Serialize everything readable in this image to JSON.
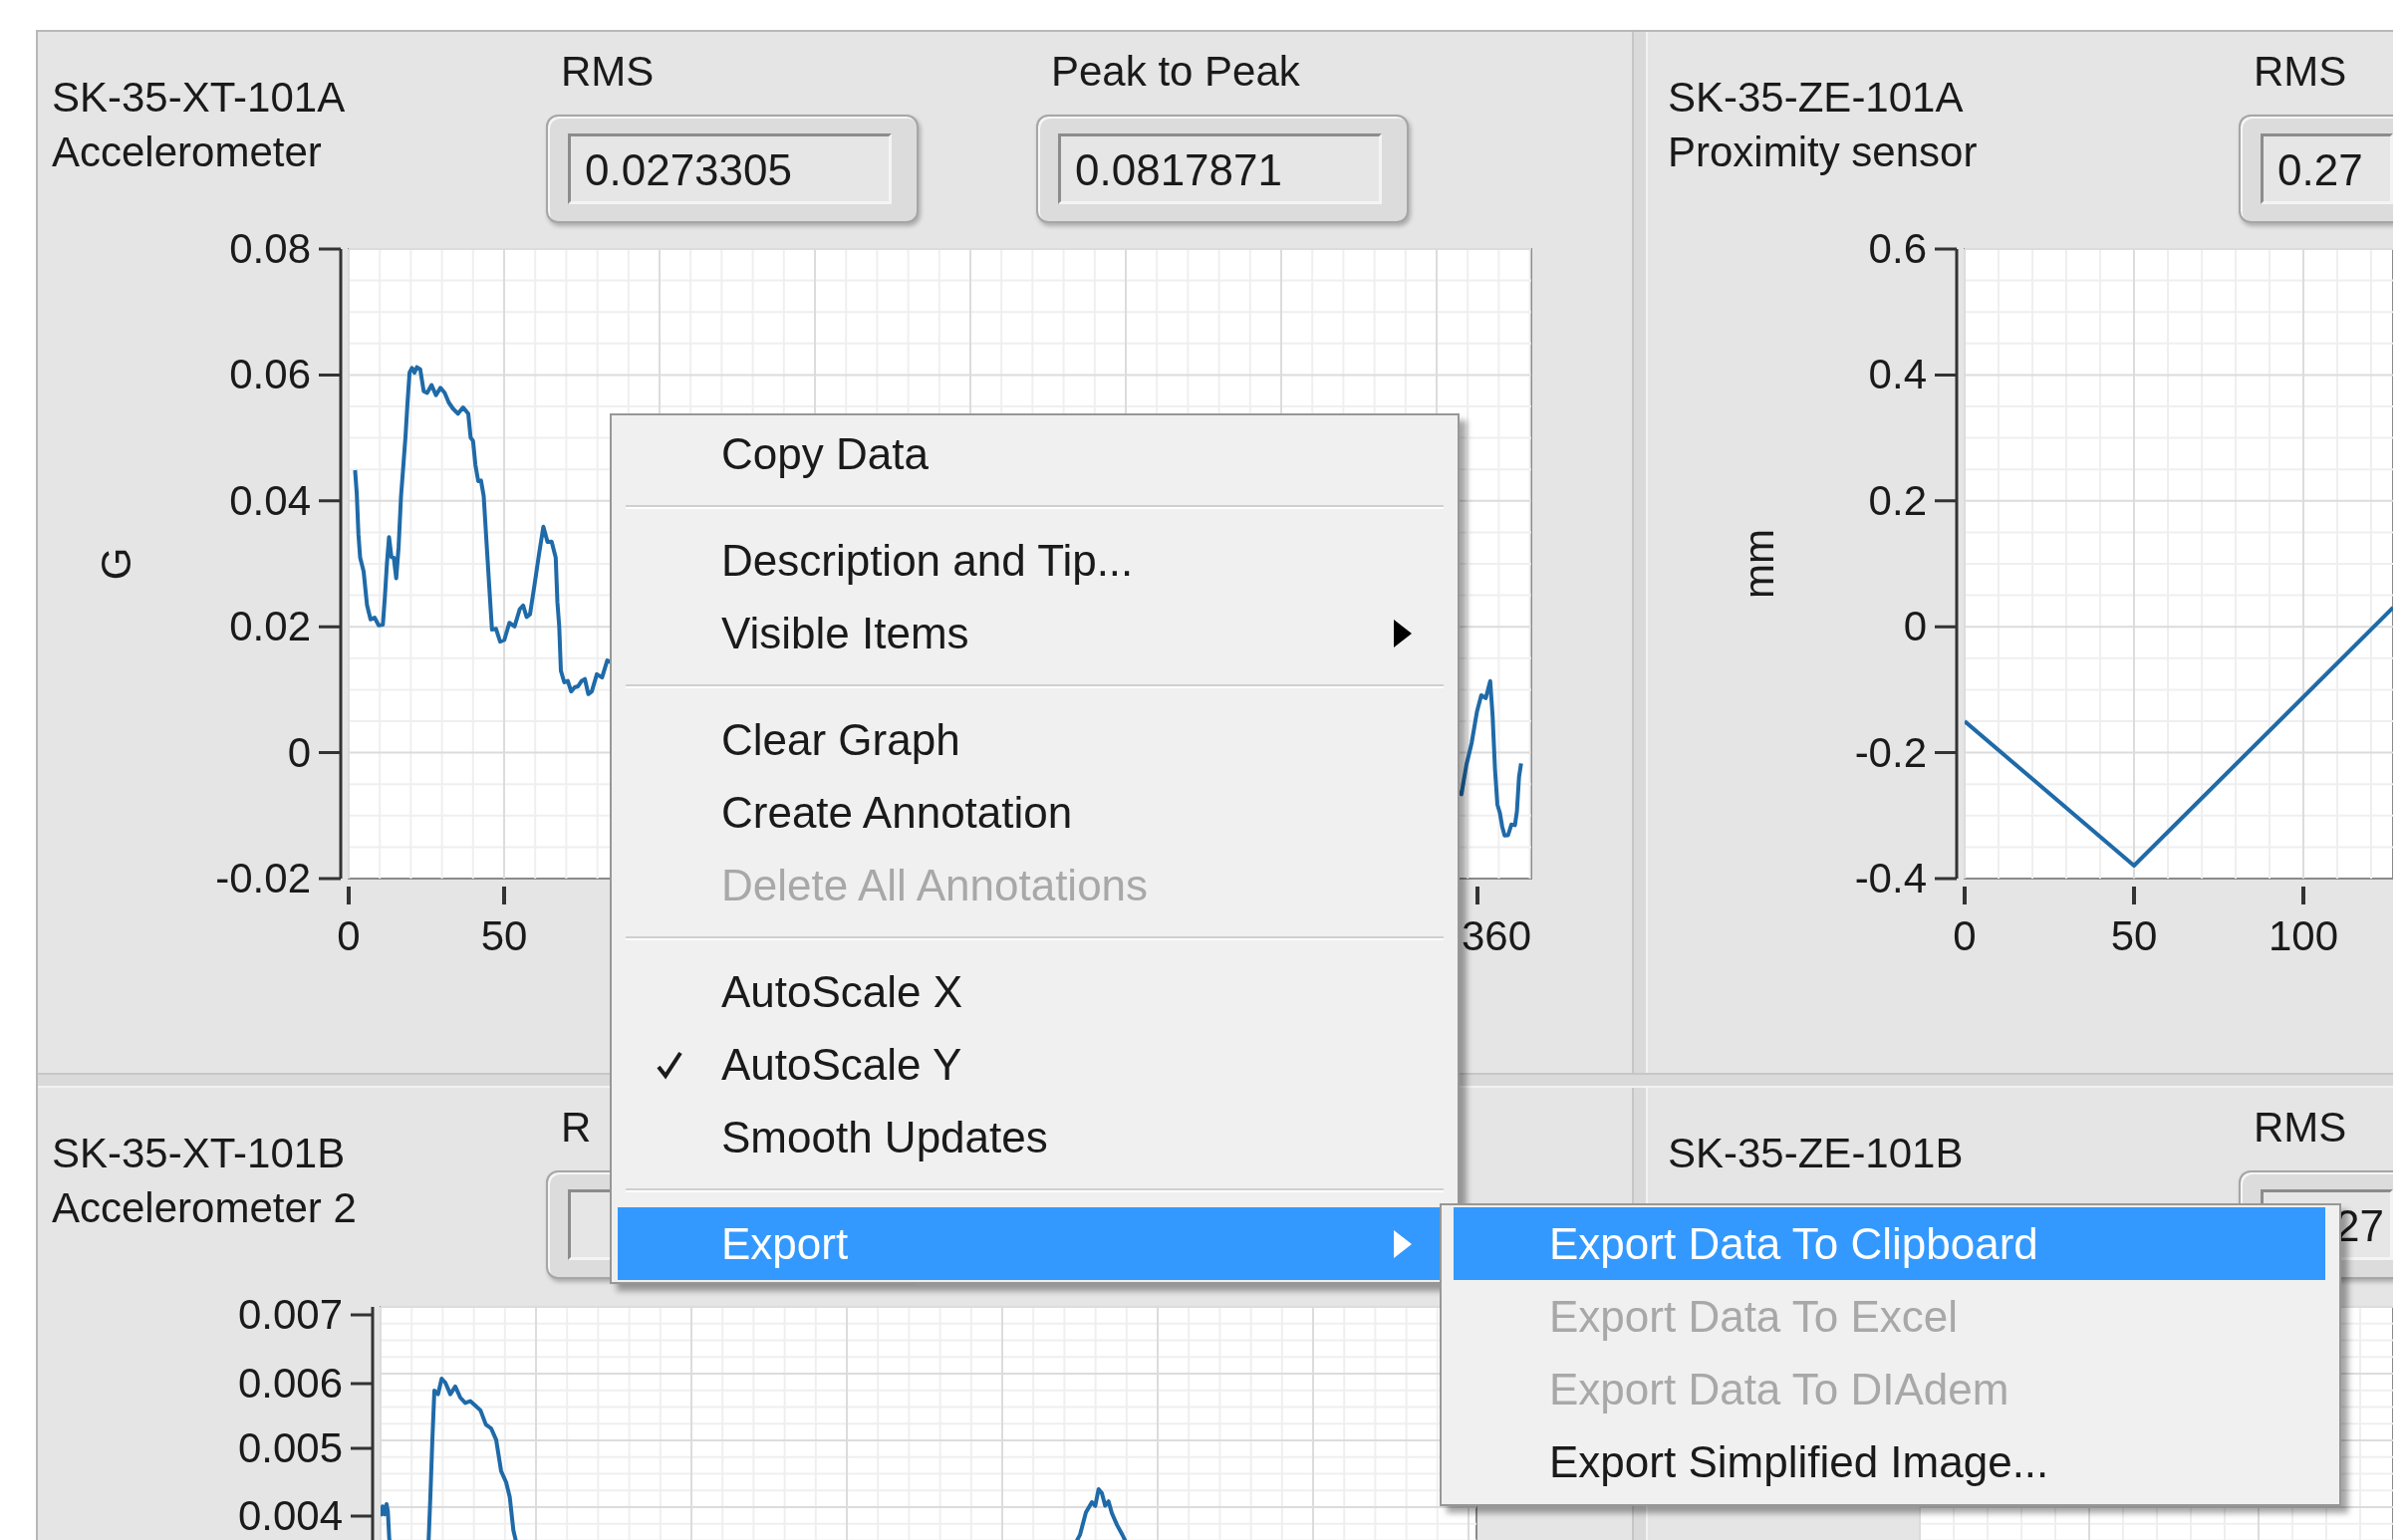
{
  "panels": [
    {
      "title": "SK-35-XT-101A",
      "subtitle": "Accelerometer",
      "readouts": [
        {
          "label": "RMS",
          "value": "0.0273305"
        },
        {
          "label": "Peak to Peak",
          "value": "0.0817871"
        }
      ],
      "graph": {
        "y_axis_label": "G",
        "y_tick_labels": [
          "0.08",
          "0.06",
          "0.04",
          "0.02",
          "0",
          "-0.02"
        ],
        "x_tick_labels": [
          "0",
          "50",
          "360"
        ]
      }
    },
    {
      "title": "SK-35-ZE-101A",
      "subtitle": "Proximity sensor",
      "readouts": [
        {
          "label": "RMS",
          "value": "0.27"
        }
      ],
      "graph": {
        "y_axis_label": "mm",
        "y_tick_labels": [
          "0.6",
          "0.4",
          "0.2",
          "0",
          "-0.2",
          "-0.4"
        ],
        "x_tick_labels": [
          "0",
          "50",
          "100"
        ]
      }
    },
    {
      "title": "SK-35-XT-101B",
      "subtitle": "Accelerometer 2",
      "readouts": [
        {
          "label": "R"
        }
      ],
      "graph": {
        "y_tick_labels": [
          "0.007",
          "0.006",
          "0.005",
          "0.004"
        ]
      }
    },
    {
      "title": "SK-35-ZE-101B",
      "readouts": [
        {
          "label": "RMS",
          "value": "27"
        }
      ]
    }
  ],
  "context_menu": {
    "sections": [
      {
        "items": [
          {
            "label": "Copy Data",
            "disabled": false,
            "checked": false,
            "selected": false,
            "has_submenu": false
          }
        ]
      },
      {
        "items": [
          {
            "label": "Description and Tip...",
            "disabled": false,
            "checked": false,
            "selected": false,
            "has_submenu": false
          },
          {
            "label": "Visible Items",
            "disabled": false,
            "checked": false,
            "selected": false,
            "has_submenu": true
          }
        ]
      },
      {
        "items": [
          {
            "label": "Clear Graph",
            "disabled": false,
            "checked": false,
            "selected": false,
            "has_submenu": false
          },
          {
            "label": "Create Annotation",
            "disabled": false,
            "checked": false,
            "selected": false,
            "has_submenu": false
          },
          {
            "label": "Delete All Annotations",
            "disabled": true,
            "checked": false,
            "selected": false,
            "has_submenu": false
          }
        ]
      },
      {
        "items": [
          {
            "label": "AutoScale X",
            "disabled": false,
            "checked": false,
            "selected": false,
            "has_submenu": false
          },
          {
            "label": "AutoScale Y",
            "disabled": false,
            "checked": true,
            "selected": false,
            "has_submenu": false
          },
          {
            "label": "Smooth Updates",
            "disabled": false,
            "checked": false,
            "selected": false,
            "has_submenu": false
          }
        ]
      },
      {
        "items": [
          {
            "label": "Export",
            "disabled": false,
            "checked": false,
            "selected": true,
            "has_submenu": true
          }
        ]
      }
    ]
  },
  "submenu": {
    "items": [
      {
        "label": "Export Data To Clipboard",
        "disabled": false,
        "selected": true
      },
      {
        "label": "Export Data To Excel",
        "disabled": true,
        "selected": false
      },
      {
        "label": "Export Data To DIAdem",
        "disabled": true,
        "selected": false
      },
      {
        "label": "Export Simplified Image...",
        "disabled": false,
        "selected": false
      }
    ]
  }
}
